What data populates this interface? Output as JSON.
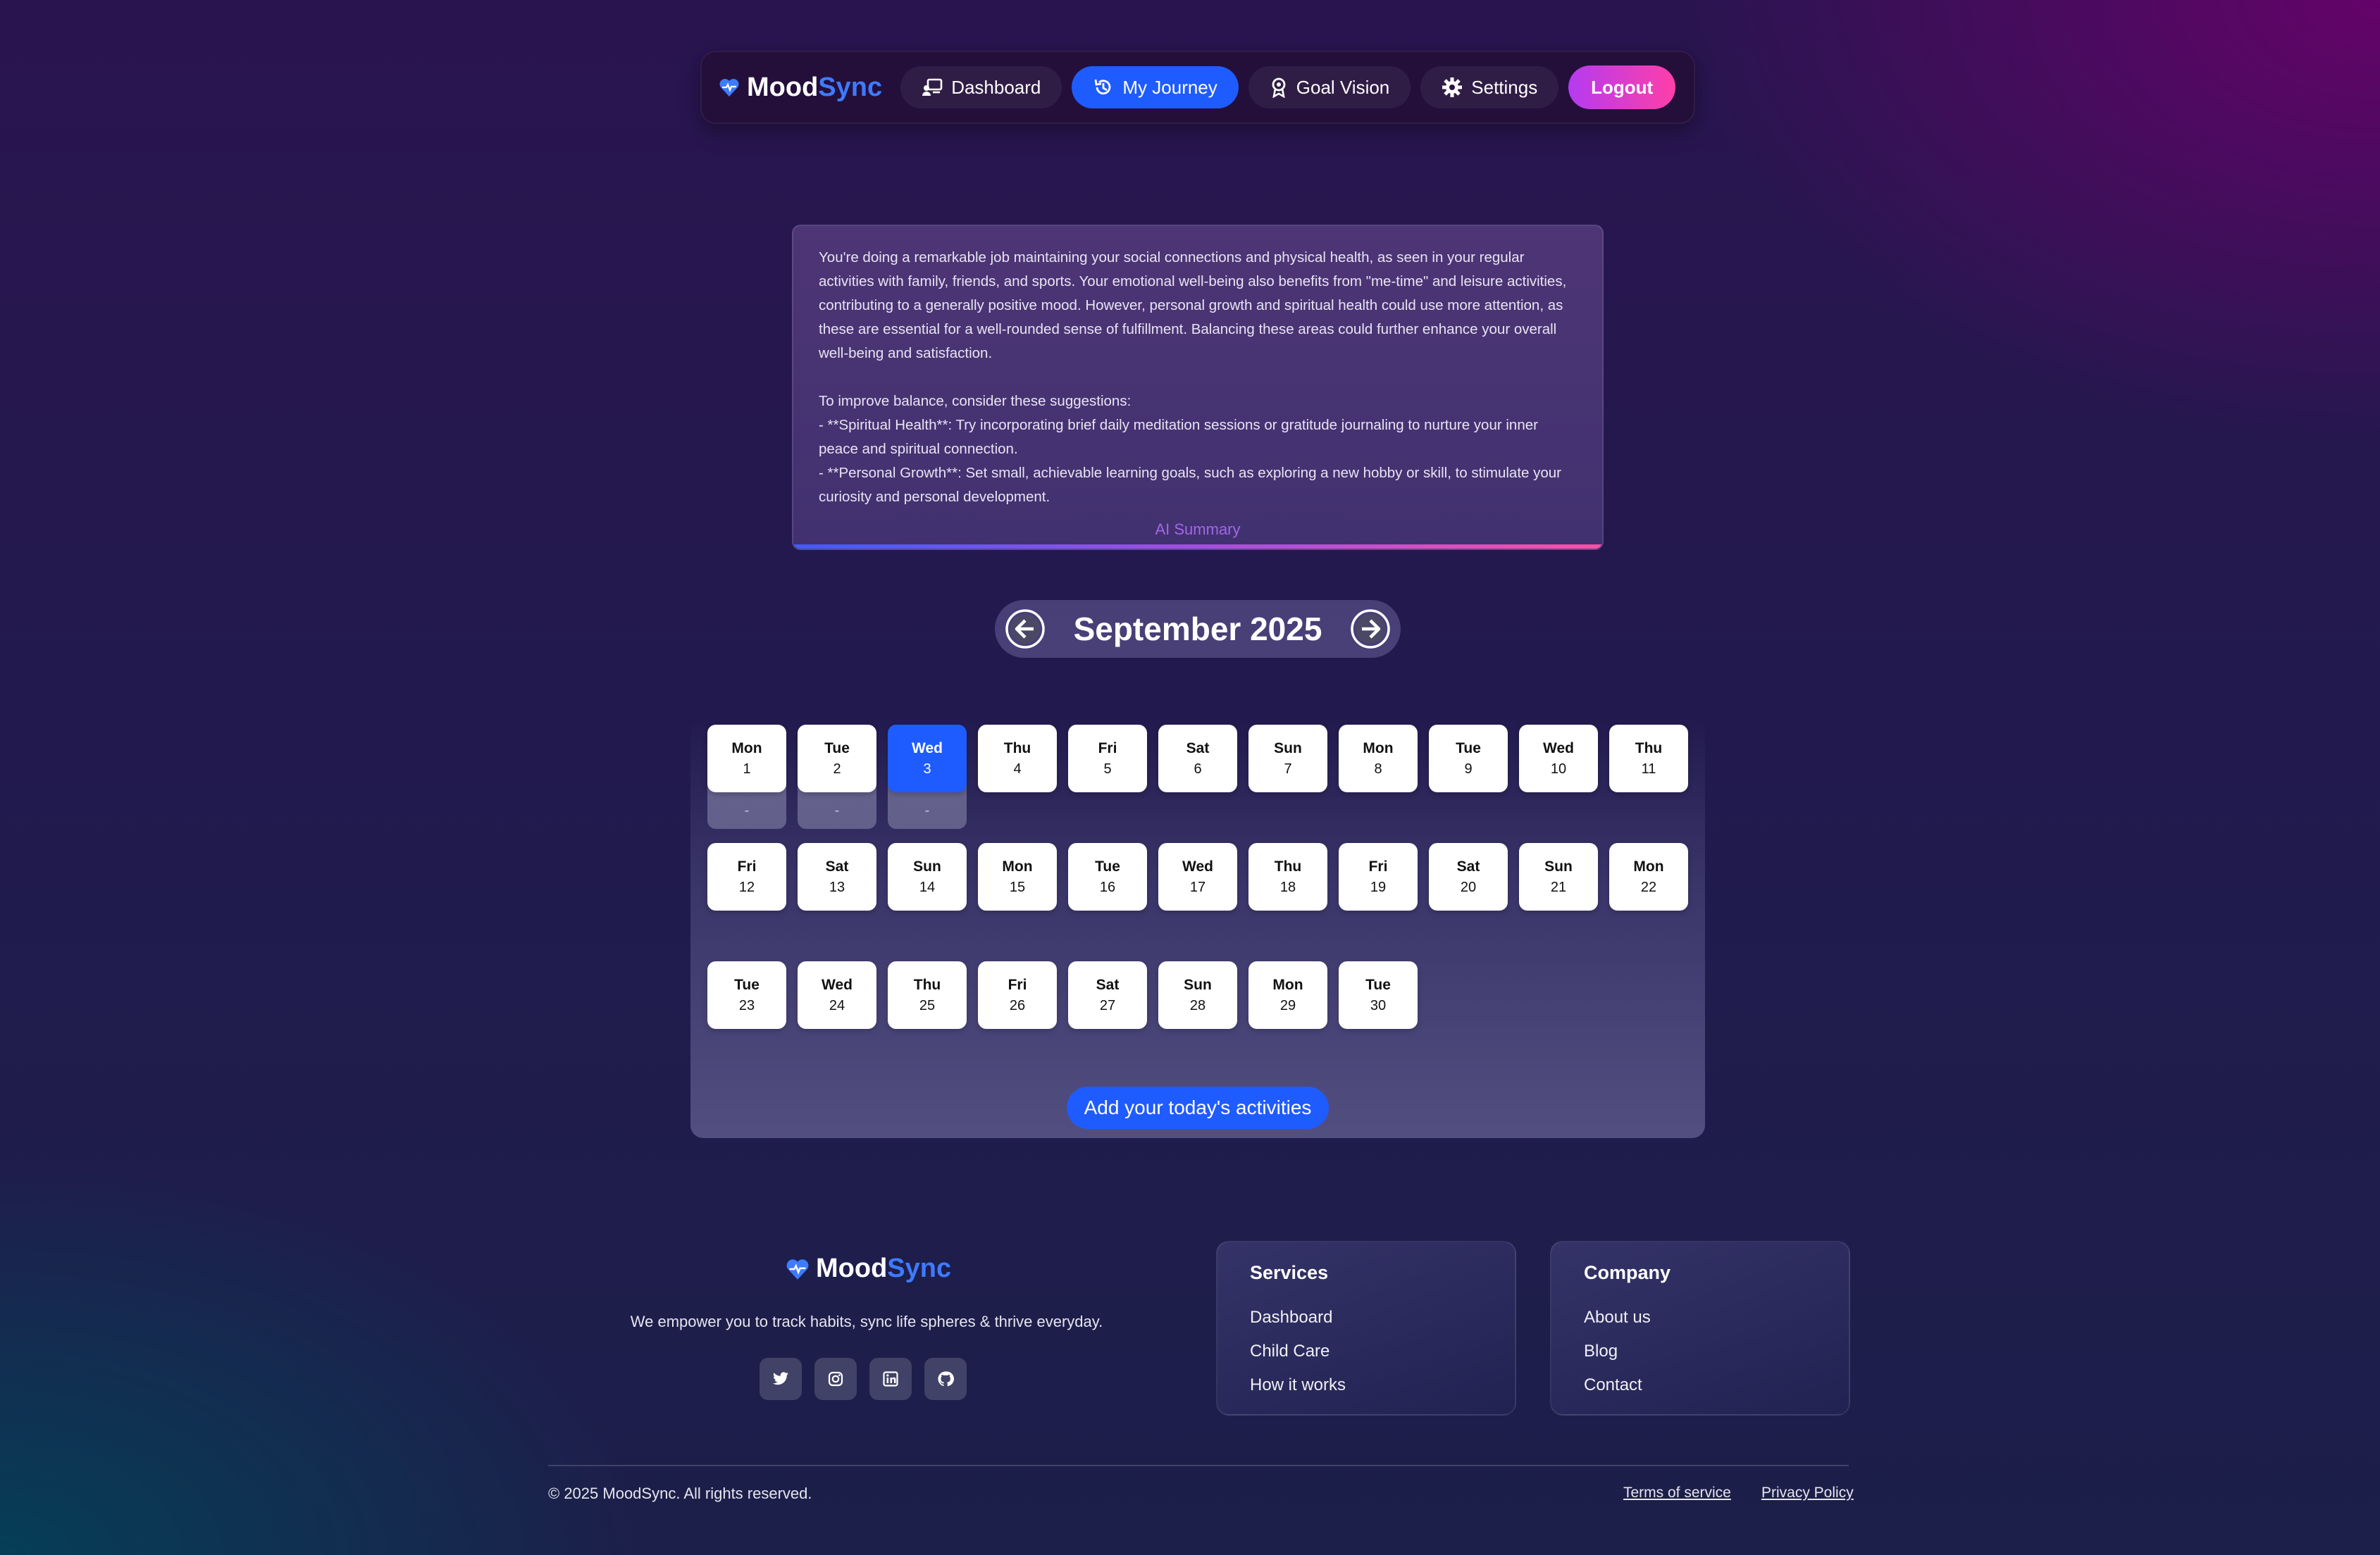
{
  "nav": {
    "brand_part1": "Mood",
    "brand_part2": "Sync",
    "items": [
      {
        "label": "Dashboard",
        "icon": "dashboard-icon"
      },
      {
        "label": "My Journey",
        "icon": "history-icon"
      },
      {
        "label": "Goal Vision",
        "icon": "award-icon"
      },
      {
        "label": "Settings",
        "icon": "gear-icon"
      }
    ],
    "active": "My Journey",
    "logout_label": "Logout"
  },
  "summary": {
    "text": "You're doing a remarkable job maintaining your social connections and physical health, as seen in your regular activities with family, friends, and sports. Your emotional well-being also benefits from \"me-time\" and leisure activities, contributing to a generally positive mood. However, personal growth and spiritual health could use more attention, as these are essential for a well-rounded sense of fulfillment. Balancing these areas could further enhance your overall well-being and satisfaction.\n\nTo improve balance, consider these suggestions:\n- **Spiritual Health**: Try incorporating brief daily meditation sessions or gratitude journaling to nurture your inner peace and spiritual connection.\n- **Personal Growth**: Set small, achievable learning goals, such as exploring a new hobby or skill, to stimulate your curiosity and personal development.",
    "label": "AI Summary"
  },
  "calendar": {
    "month_title": "September 2025",
    "days": [
      {
        "dow": "Mon",
        "num": "1",
        "mood": "-"
      },
      {
        "dow": "Tue",
        "num": "2",
        "mood": "-"
      },
      {
        "dow": "Wed",
        "num": "3",
        "mood": "-",
        "selected": true
      },
      {
        "dow": "Thu",
        "num": "4"
      },
      {
        "dow": "Fri",
        "num": "5"
      },
      {
        "dow": "Sat",
        "num": "6"
      },
      {
        "dow": "Sun",
        "num": "7"
      },
      {
        "dow": "Mon",
        "num": "8"
      },
      {
        "dow": "Tue",
        "num": "9"
      },
      {
        "dow": "Wed",
        "num": "10"
      },
      {
        "dow": "Thu",
        "num": "11"
      },
      {
        "dow": "Fri",
        "num": "12"
      },
      {
        "dow": "Sat",
        "num": "13"
      },
      {
        "dow": "Sun",
        "num": "14"
      },
      {
        "dow": "Mon",
        "num": "15"
      },
      {
        "dow": "Tue",
        "num": "16"
      },
      {
        "dow": "Wed",
        "num": "17"
      },
      {
        "dow": "Thu",
        "num": "18"
      },
      {
        "dow": "Fri",
        "num": "19"
      },
      {
        "dow": "Sat",
        "num": "20"
      },
      {
        "dow": "Sun",
        "num": "21"
      },
      {
        "dow": "Mon",
        "num": "22"
      },
      {
        "dow": "Tue",
        "num": "23"
      },
      {
        "dow": "Wed",
        "num": "24"
      },
      {
        "dow": "Thu",
        "num": "25"
      },
      {
        "dow": "Fri",
        "num": "26"
      },
      {
        "dow": "Sat",
        "num": "27"
      },
      {
        "dow": "Sun",
        "num": "28"
      },
      {
        "dow": "Mon",
        "num": "29"
      },
      {
        "dow": "Tue",
        "num": "30"
      }
    ],
    "add_button": "Add your today's activities"
  },
  "footer": {
    "brand_part1": "Mood",
    "brand_part2": "Sync",
    "tagline": "We empower you to track habits, sync life spheres & thrive everyday.",
    "socials": [
      "twitter-icon",
      "instagram-icon",
      "linkedin-icon",
      "github-icon"
    ],
    "services": {
      "title": "Services",
      "links": [
        "Dashboard",
        "Child Care",
        "How it works"
      ]
    },
    "company": {
      "title": "Company",
      "links": [
        "About us",
        "Blog",
        "Contact"
      ]
    },
    "copyright": "© 2025 MoodSync. All rights reserved.",
    "terms": "Terms of service",
    "privacy": "Privacy Policy"
  },
  "colors": {
    "accent": "#1f5cff",
    "brand_blue": "#3d7bff",
    "logout_start": "#b43bf0",
    "logout_end": "#ff3fa8",
    "summary_label": "#a267e6"
  }
}
